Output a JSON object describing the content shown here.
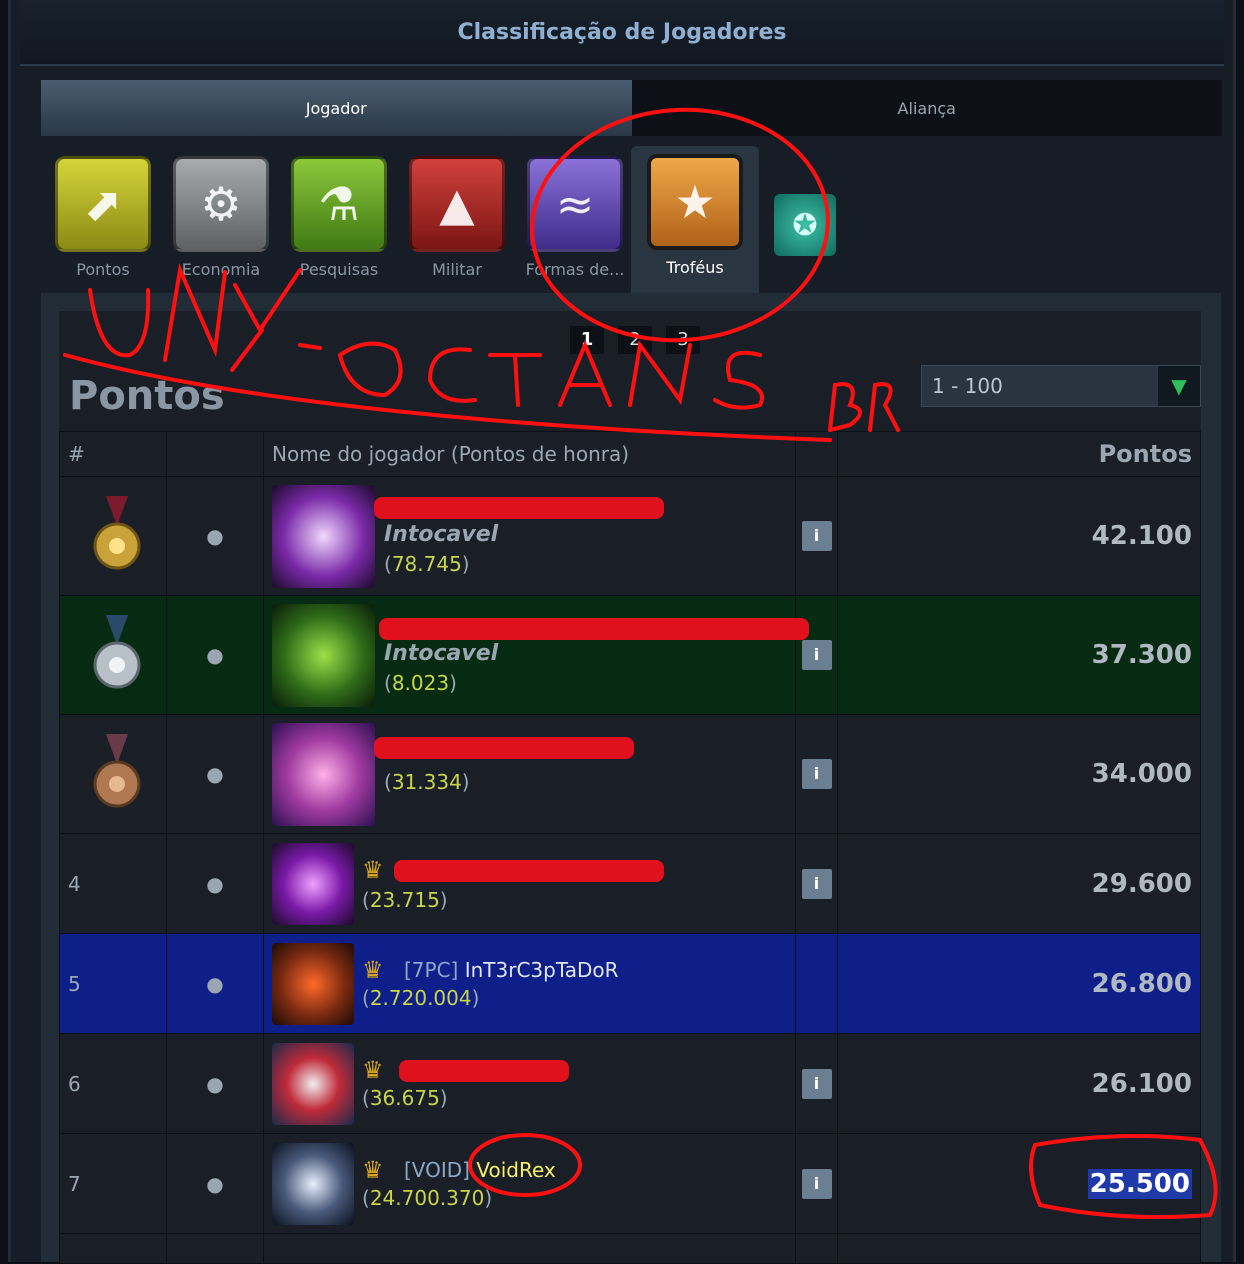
{
  "title": "Classificação de Jogadores",
  "tabs": [
    {
      "label": "Jogador",
      "active": true
    },
    {
      "label": "Aliança",
      "active": false
    }
  ],
  "categories": [
    {
      "label": "Pontos",
      "icon": "trend-arrow-icon",
      "color": "#b7b52a"
    },
    {
      "label": "Economia",
      "icon": "factory-gear-icon",
      "color": "#8e9194"
    },
    {
      "label": "Pesquisas",
      "icon": "flask-icon",
      "color": "#6cae2a"
    },
    {
      "label": "Militar",
      "icon": "fleet-ships-icon",
      "color": "#b5302e"
    },
    {
      "label": "Formas de...",
      "icon": "dna-icon",
      "color": "#6a55b8"
    },
    {
      "label": "Troféus",
      "icon": "trophy-medal-icon",
      "color": "#d98a2a",
      "selected": true
    }
  ],
  "pages": [
    "1",
    "2",
    "3"
  ],
  "current_page": "1",
  "section_heading": "Pontos",
  "range_select": "1 - 100",
  "columns": {
    "rank": "#",
    "name": "Nome do jogador (Pontos de honra)",
    "points": "Pontos"
  },
  "rows": [
    {
      "rank": "",
      "medal": "gold",
      "name": "Intocavel",
      "alliance": "",
      "honor": "78.745",
      "points": "42.100"
    },
    {
      "rank": "",
      "medal": "silver",
      "name": "Intocavel",
      "alliance": "",
      "honor": "8.023",
      "points": "37.300"
    },
    {
      "rank": "",
      "medal": "bronze",
      "name": "",
      "alliance": "",
      "honor": "31.334",
      "points": "34.000"
    },
    {
      "rank": "4",
      "medal": "",
      "name": "",
      "alliance": "",
      "honor": "23.715",
      "points": "29.600"
    },
    {
      "rank": "5",
      "medal": "",
      "name": "InT3rC3pTaDoR",
      "alliance": "[7PC]",
      "honor": "2.720.004",
      "points": "26.800"
    },
    {
      "rank": "6",
      "medal": "",
      "name": "",
      "alliance": "",
      "honor": "36.675",
      "points": "26.100"
    },
    {
      "rank": "7",
      "medal": "",
      "name": "VoidRex",
      "alliance": "[VOID]",
      "honor": "24.700.370",
      "points": "25.500"
    }
  ],
  "status_dot": "●",
  "info_label": "i",
  "colors": {
    "accent_title": "#8fb0d0",
    "own_row": "#0f1f8a",
    "highlight_row": "#072b12",
    "honor": "#c8d44a"
  },
  "annotations": {
    "scrawl_text": "UNY OCTANS BR"
  }
}
